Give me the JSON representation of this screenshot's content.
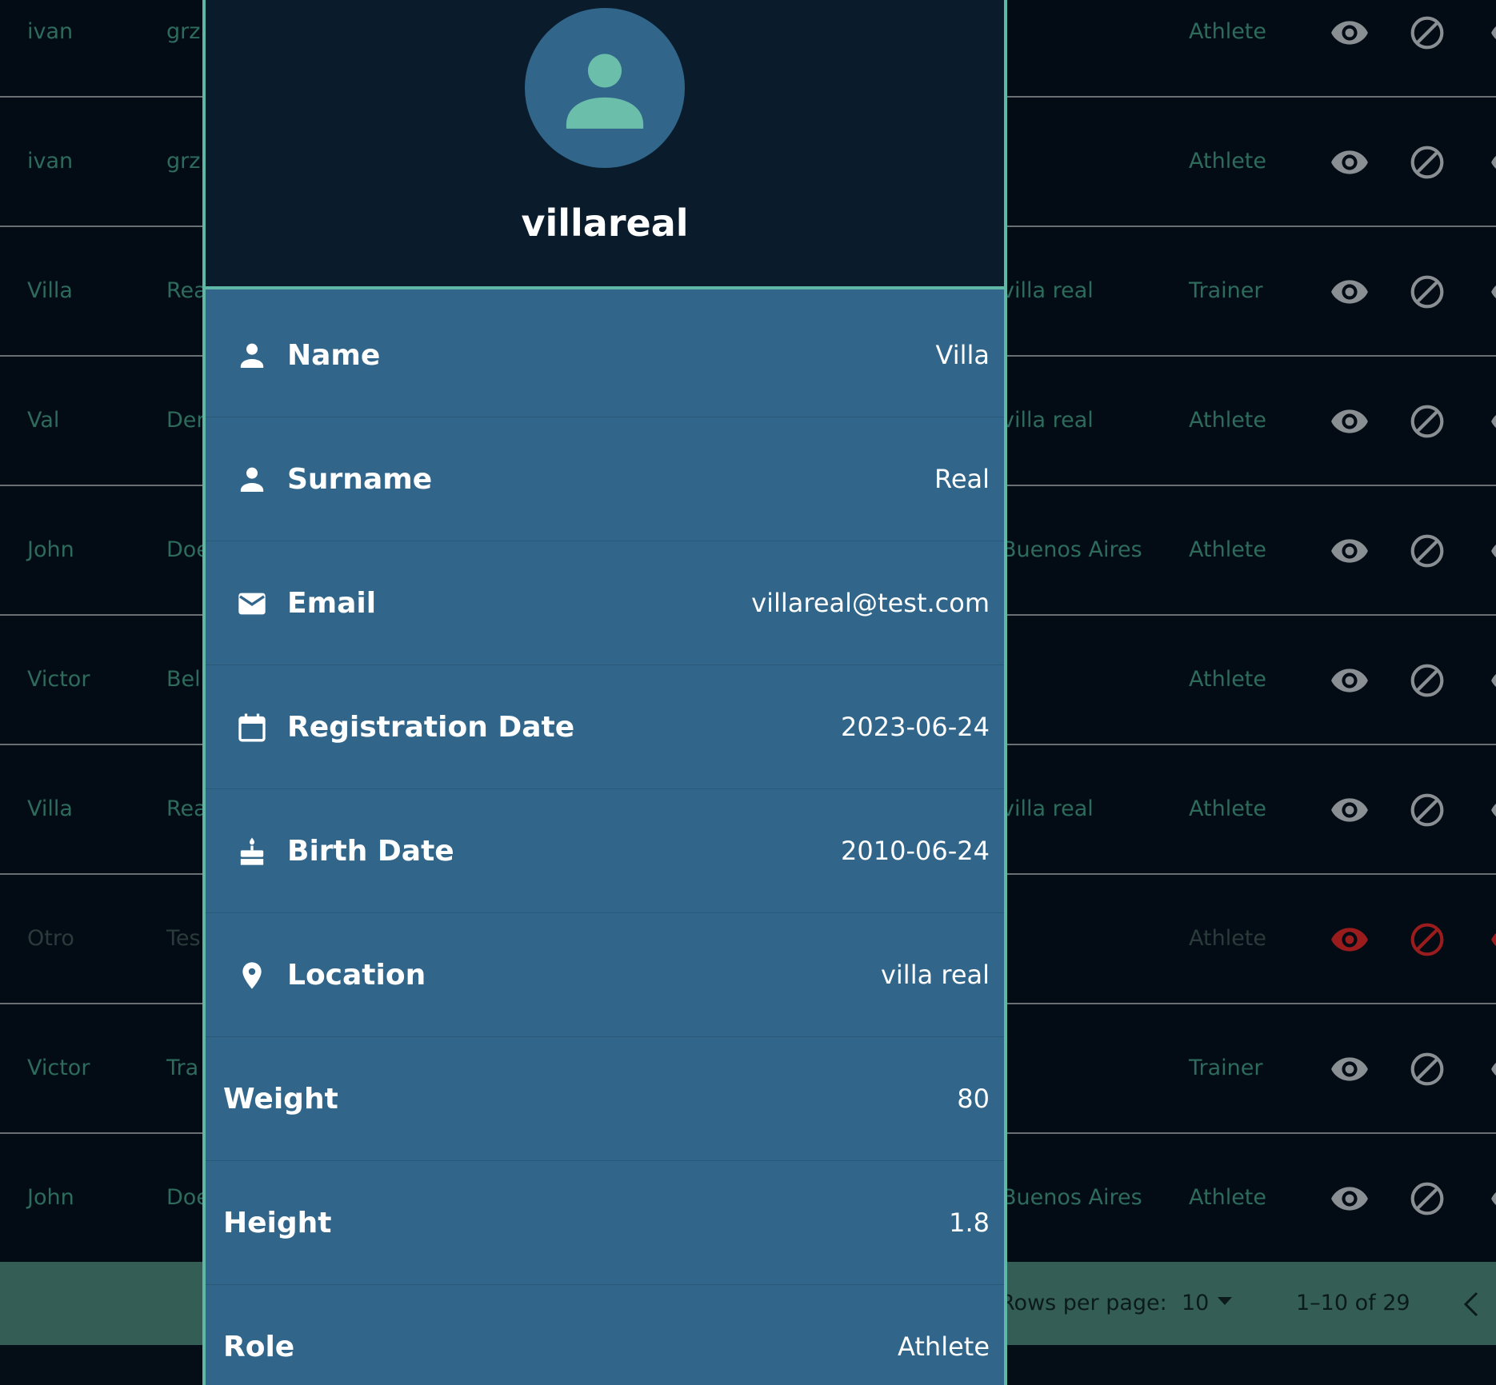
{
  "table": {
    "rows": [
      {
        "first": "ivan",
        "last": "grz",
        "location": "",
        "role": "Athlete",
        "faded": false
      },
      {
        "first": "ivan",
        "last": "grz",
        "location": "",
        "role": "Athlete",
        "faded": false
      },
      {
        "first": "Villa",
        "last": "Rea",
        "location": "villa real",
        "role": "Trainer",
        "faded": false
      },
      {
        "first": "Val",
        "last": "Der",
        "location": "villa real",
        "role": "Athlete",
        "faded": false
      },
      {
        "first": "John",
        "last": "Doe",
        "location": "Buenos Aires",
        "role": "Athlete",
        "faded": false
      },
      {
        "first": "Victor",
        "last": "Bel",
        "location": "",
        "role": "Athlete",
        "faded": false
      },
      {
        "first": "Villa",
        "last": "Rea",
        "location": "villa real",
        "role": "Athlete",
        "faded": false
      },
      {
        "first": "Otro",
        "last": "Tes",
        "location": "",
        "role": "Athlete",
        "faded": true
      },
      {
        "first": "Victor",
        "last": "Tra",
        "location": "",
        "role": "Trainer",
        "faded": false
      },
      {
        "first": "John",
        "last": "Doe",
        "location": "Buenos Aires",
        "role": "Athlete",
        "faded": false
      }
    ],
    "icons": {
      "view": "eye-icon",
      "block": "block-icon"
    },
    "colors": {
      "icon": "#8a8f94",
      "icon_faded": "#9a1c1c"
    }
  },
  "footer": {
    "rows_per_page_label": "Rows per page:",
    "rows_per_page_value": "10",
    "range": "1–10 of 29"
  },
  "modal": {
    "username": "villareal",
    "fields": [
      {
        "label": "Name",
        "value": "Villa",
        "icon": "person-icon"
      },
      {
        "label": "Surname",
        "value": "Real",
        "icon": "person-icon"
      },
      {
        "label": "Email",
        "value": "villareal@test.com",
        "icon": "email-icon"
      },
      {
        "label": "Registration Date",
        "value": "2023-06-24",
        "icon": "calendar-icon"
      },
      {
        "label": "Birth Date",
        "value": "2010-06-24",
        "icon": "cake-icon"
      },
      {
        "label": "Location",
        "value": "villa real",
        "icon": "location-pin-icon"
      },
      {
        "label": "Weight",
        "value": "80",
        "icon": ""
      },
      {
        "label": "Height",
        "value": "1.8",
        "icon": ""
      },
      {
        "label": "Role",
        "value": "Athlete",
        "icon": ""
      }
    ],
    "colors": {
      "header_bg": "#0a1c2c",
      "body_bg": "#31668a",
      "accent": "#5fb7a6"
    }
  }
}
